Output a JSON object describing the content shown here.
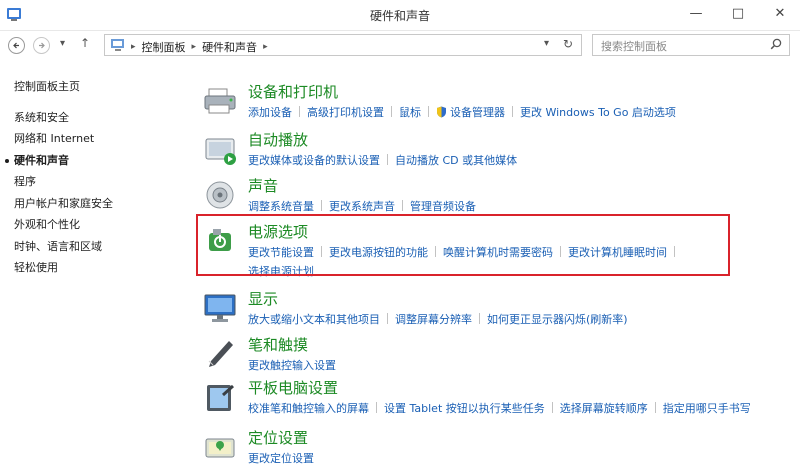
{
  "window": {
    "title": "硬件和声音",
    "min_label": "—",
    "max_label": "□",
    "close_label": "✕"
  },
  "nav": {
    "back_icon": "back-arrow-icon",
    "forward_icon": "forward-arrow-icon",
    "recent_label": "▾",
    "up_label": "↑"
  },
  "address": {
    "crumbs": [
      "控制面板",
      "硬件和声音"
    ],
    "separator": "▸",
    "dropdown": "▾",
    "refresh": "↻"
  },
  "search": {
    "placeholder": "搜索控制面板"
  },
  "sidebar": {
    "home": "控制面板主页",
    "items": [
      {
        "label": "系统和安全",
        "current": false
      },
      {
        "label": "网络和 Internet",
        "current": false
      },
      {
        "label": "硬件和声音",
        "current": true
      },
      {
        "label": "程序",
        "current": false
      },
      {
        "label": "用户帐户和家庭安全",
        "current": false
      },
      {
        "label": "外观和个性化",
        "current": false
      },
      {
        "label": "时钟、语言和区域",
        "current": false
      },
      {
        "label": "轻松使用",
        "current": false
      }
    ]
  },
  "categories": [
    {
      "title": "设备和打印机",
      "icon": "printer-icon",
      "lines": [
        [
          "添加设备",
          "高级打印机设置",
          "鼠标",
          "设备管理器",
          "更改 Windows To Go 启动选项"
        ]
      ]
    },
    {
      "title": "自动播放",
      "icon": "autoplay-icon",
      "lines": [
        [
          "更改媒体或设备的默认设置",
          "自动播放 CD 或其他媒体"
        ]
      ]
    },
    {
      "title": "声音",
      "icon": "speaker-icon",
      "lines": [
        [
          "调整系统音量",
          "更改系统声音",
          "管理音频设备"
        ]
      ]
    },
    {
      "title": "电源选项",
      "icon": "power-options-icon",
      "lines": [
        [
          "更改节能设置",
          "更改电源按钮的功能",
          "唤醒计算机时需要密码",
          "更改计算机睡眠时间"
        ],
        [
          "选择电源计划"
        ]
      ]
    },
    {
      "title": "显示",
      "icon": "display-icon",
      "lines": [
        [
          "放大或缩小文本和其他项目",
          "调整屏幕分辨率",
          "如何更正显示器闪烁(刷新率)"
        ]
      ]
    },
    {
      "title": "笔和触摸",
      "icon": "pen-icon",
      "lines": [
        [
          "更改触控输入设置"
        ]
      ]
    },
    {
      "title": "平板电脑设置",
      "icon": "tablet-icon",
      "lines": [
        [
          "校准笔和触控输入的屏幕",
          "设置 Tablet 按钮以执行某些任务",
          "选择屏幕旋转顺序",
          "指定用哪只手书写"
        ]
      ]
    },
    {
      "title": "定位设置",
      "icon": "location-icon",
      "lines": [
        [
          "更改定位设置"
        ]
      ]
    }
  ],
  "colors": {
    "category_title": "#1c8a24",
    "link": "#1a5fb4",
    "highlight_box": "#d9232b"
  }
}
